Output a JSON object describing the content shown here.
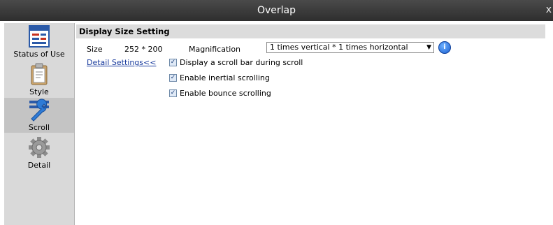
{
  "window": {
    "title": "Overlap",
    "close_glyph": "x"
  },
  "sidebar": {
    "items": [
      {
        "label": "Status of Use",
        "icon": "status-icon"
      },
      {
        "label": "Style",
        "icon": "clipboard-icon"
      },
      {
        "label": "Scroll",
        "icon": "wrench-icon",
        "active": true
      },
      {
        "label": "Detail",
        "icon": "gear-icon"
      }
    ]
  },
  "section": {
    "title": "Display Size Setting"
  },
  "size": {
    "label": "Size",
    "value": "252 * 200"
  },
  "detail_link": "Detail Settings<<",
  "magnification": {
    "label": "Magnification",
    "value": "1 times vertical * 1 times horizontal"
  },
  "checkboxes": [
    {
      "label": "Display a scroll bar during scroll",
      "checked": true
    },
    {
      "label": "Enable inertial scrolling",
      "checked": true
    },
    {
      "label": "Enable bounce scrolling",
      "checked": true
    }
  ],
  "colors": {
    "titlebar": "#3a3a3a",
    "sidebar": "#d9d9d9",
    "link": "#1a3c9e",
    "accent": "#1b5fd1"
  }
}
